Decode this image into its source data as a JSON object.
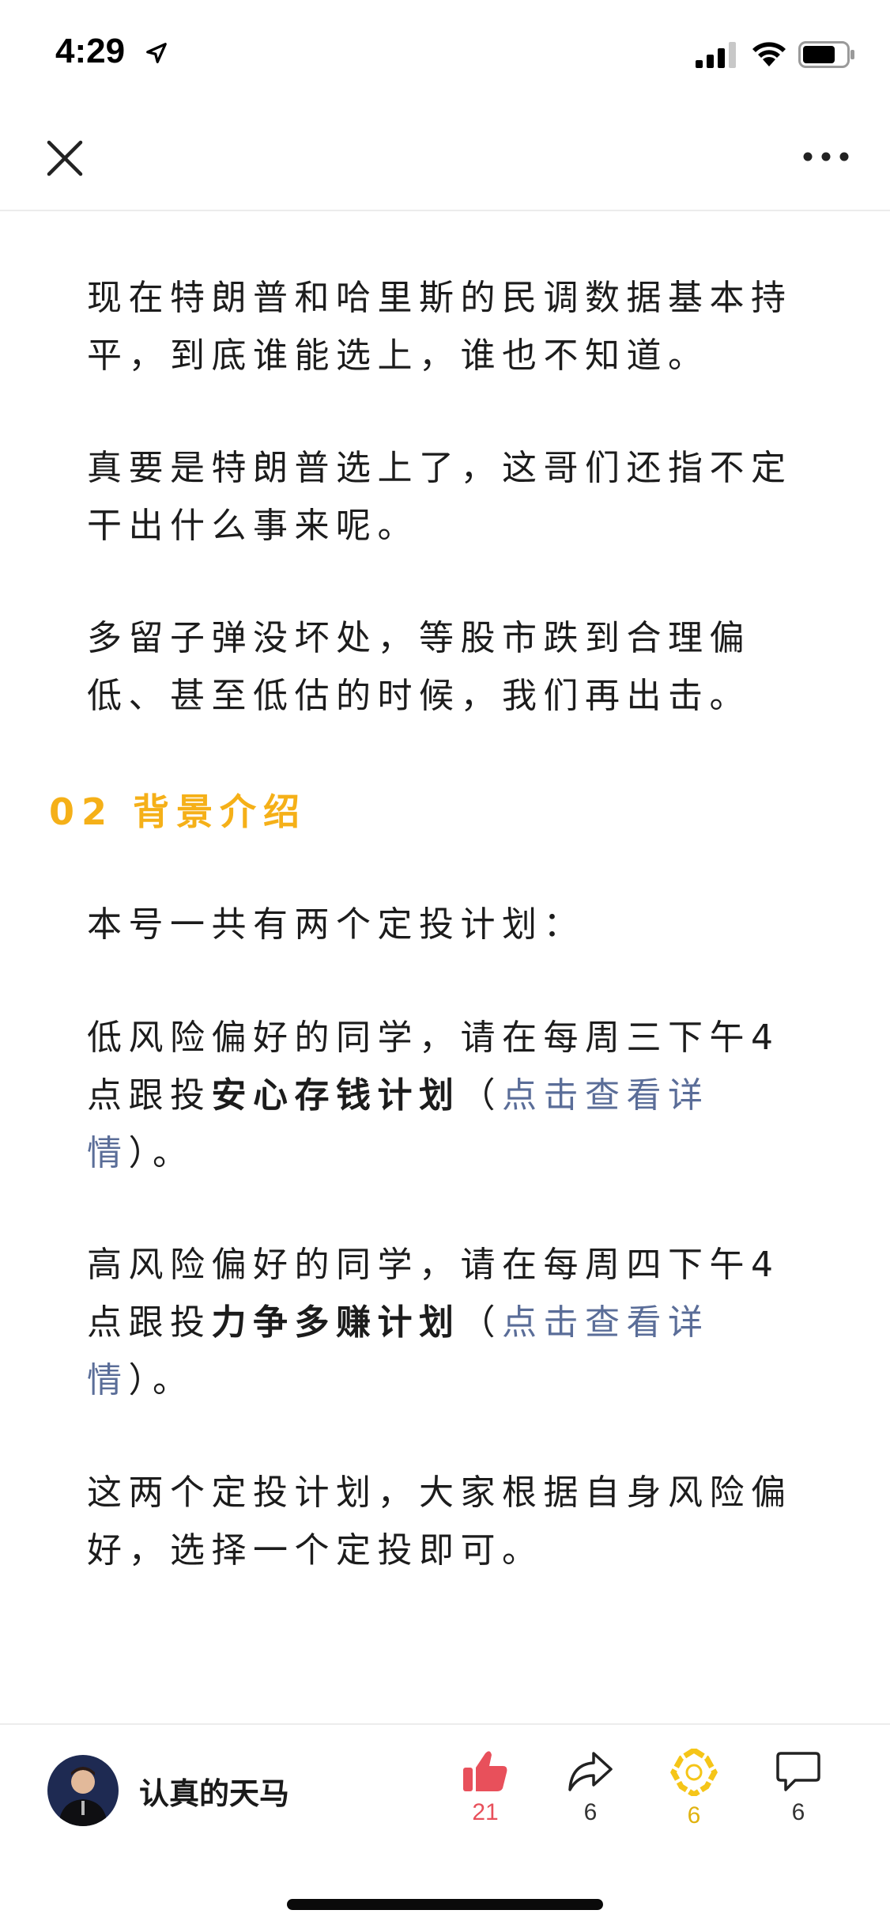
{
  "status": {
    "time": "4:29"
  },
  "paragraphs": {
    "p1": "现在特朗普和哈里斯的民调数据基本持平，到底谁能选上，谁也不知道。",
    "p2": "真要是特朗普选上了，这哥们还指不定干出什么事来呢。",
    "p3": "多留子弹没坏处，等股市跌到合理偏低、甚至低估的时候，我们再出击。",
    "p4": "本号一共有两个定投计划："
  },
  "section": {
    "number": "02",
    "title": "背景介绍"
  },
  "plan1": {
    "prefix": "低风险偏好的同学，请在每周三下午4点跟投",
    "name": "安心存钱计划",
    "open": "（",
    "link": "点击查看详情",
    "close": "）。"
  },
  "plan2": {
    "prefix": "高风险偏好的同学，请在每周四下午4点跟投",
    "name": "力争多赚计划",
    "open": "（",
    "link": "点击查看详情",
    "close": "）。"
  },
  "closing": "这两个定投计划，大家根据自身风险偏好，选择一个定投即可。",
  "footer": {
    "author": "认真的天马",
    "like_count": "21",
    "share_count": "6",
    "wow_count": "6",
    "comment_count": "6"
  },
  "colors": {
    "accent": "#f5b018",
    "like": "#e8505b",
    "link": "#5a6d98"
  },
  "icons": [
    "close-icon",
    "more-icon",
    "thumbs-up-icon",
    "share-icon",
    "wow-icon",
    "comment-icon"
  ]
}
